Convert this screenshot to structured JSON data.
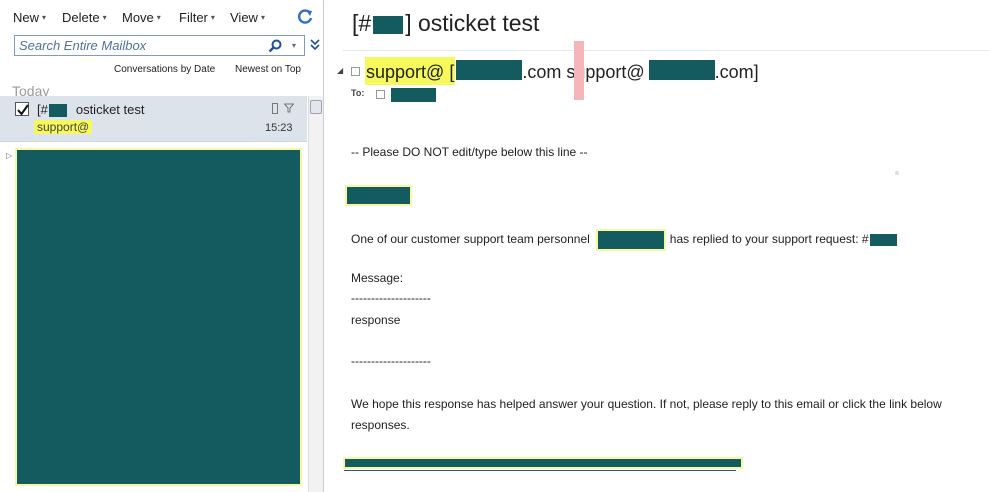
{
  "toolbar": {
    "new_label": "New",
    "delete_label": "Delete",
    "move_label": "Move",
    "filter_label": "Filter",
    "view_label": "View",
    "caret_glyph": "▾"
  },
  "search": {
    "placeholder": "Search Entire Mailbox"
  },
  "sort": {
    "by_label": "Conversations by Date",
    "order_label": "Newest on Top"
  },
  "groups": {
    "today": "Today"
  },
  "conversation": {
    "subject_prefix": "[#",
    "subject_suffix": "osticket test",
    "sender": "support@",
    "time": "15:23"
  },
  "message": {
    "title_prefix": "[#",
    "title_suffix": "] osticket test",
    "from_name": "support@",
    "from_mid_open": "[",
    "from_dotcom_1": ".com support@",
    "from_dotcom_2": ".com]",
    "to_label": "To:",
    "body": {
      "do_not_edit": "-- Please DO NOT edit/type below this line --",
      "replied_prefix": "One of our customer support team personnel",
      "replied_suffix": "has replied to your support request: #",
      "message_label": "Message:",
      "separator": "--------------------",
      "response": "response",
      "hope_line": "We hope this response has helped answer your question. If not, please reply to this email or click the link below",
      "responses": "responses."
    }
  },
  "colors": {
    "redaction": "#135b5e",
    "highlight": "#f5f95c",
    "selected_row": "#dde3ea"
  }
}
